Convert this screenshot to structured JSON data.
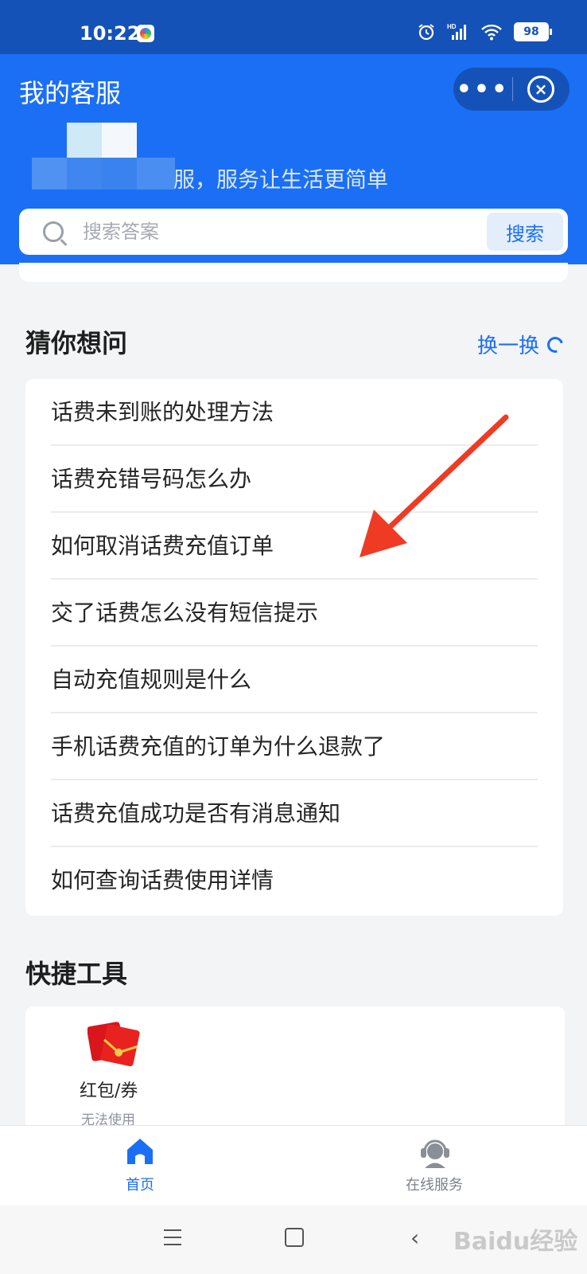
{
  "status_bar": {
    "time": "10:22",
    "battery": "98",
    "icons": [
      "app-icon",
      "alarm-icon",
      "hd-signal-icon",
      "wifi-icon",
      "battery-icon"
    ]
  },
  "header": {
    "title": "我的客服",
    "capsule_more": "•••",
    "capsule_close": "×",
    "slogan": "服，服务让生活更简单"
  },
  "search": {
    "placeholder": "搜索答案",
    "button": "搜索"
  },
  "guess": {
    "title": "猜你想问",
    "refresh": "换一换",
    "questions": [
      "话费未到账的处理方法",
      "话费充错号码怎么办",
      "如何取消话费充值订单",
      "交了话费怎么没有短信提示",
      "自动充值规则是什么",
      "手机话费充值的订单为什么退款了",
      "话费充值成功是否有消息通知",
      "如何查询话费使用详情"
    ]
  },
  "tools": {
    "title": "快捷工具",
    "items": [
      {
        "label": "红包/券",
        "sublabel": "无法使用",
        "icon": "red-packet-icon"
      }
    ]
  },
  "tab_bar": {
    "tabs": [
      {
        "label": "首页",
        "icon": "home-icon",
        "active": true
      },
      {
        "label": "在线服务",
        "icon": "customer-service-icon",
        "active": false
      }
    ]
  },
  "watermark": "Baidu经验",
  "colors": {
    "primary": "#1b6ff5",
    "status_bar": "#1552b8",
    "annotation_arrow": "#ef3b24"
  }
}
